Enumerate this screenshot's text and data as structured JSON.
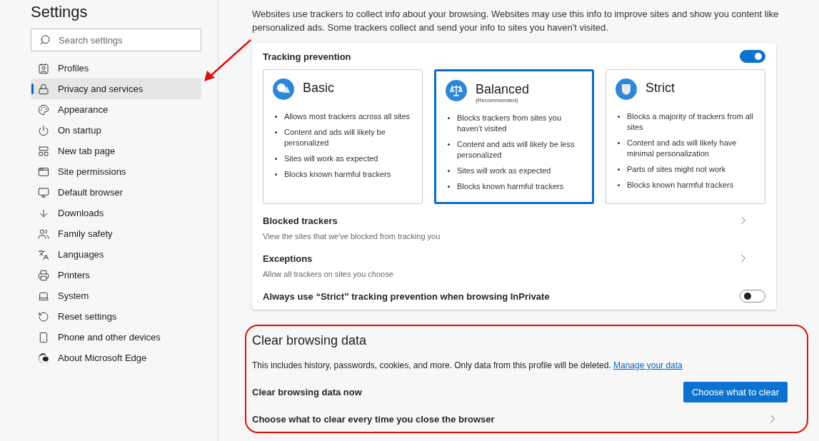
{
  "sidebar": {
    "title": "Settings",
    "search": {
      "placeholder": "Search settings"
    },
    "items": [
      {
        "label": "Profiles",
        "selected": false
      },
      {
        "label": "Privacy and services",
        "selected": true
      },
      {
        "label": "Appearance",
        "selected": false
      },
      {
        "label": "On startup",
        "selected": false
      },
      {
        "label": "New tab page",
        "selected": false
      },
      {
        "label": "Site permissions",
        "selected": false
      },
      {
        "label": "Default browser",
        "selected": false
      },
      {
        "label": "Downloads",
        "selected": false
      },
      {
        "label": "Family safety",
        "selected": false
      },
      {
        "label": "Languages",
        "selected": false
      },
      {
        "label": "Printers",
        "selected": false
      },
      {
        "label": "System",
        "selected": false
      },
      {
        "label": "Reset settings",
        "selected": false
      },
      {
        "label": "Phone and other devices",
        "selected": false
      },
      {
        "label": "About Microsoft Edge",
        "selected": false
      }
    ]
  },
  "intro": "Websites use trackers to collect info about your browsing. Websites may use this info to improve sites and show you content like personalized ads. Some trackers collect and send your info to sites you haven't visited.",
  "tracking": {
    "title": "Tracking prevention",
    "on": true,
    "levels": [
      {
        "title": "Basic",
        "selected": false,
        "bullets": [
          "Allows most trackers across all sites",
          "Content and ads will likely be personalized",
          "Sites will work as expected",
          "Blocks known harmful trackers"
        ]
      },
      {
        "title": "Balanced",
        "subtitle": "(Recommended)",
        "selected": true,
        "bullets": [
          "Blocks trackers from sites you haven't visited",
          "Content and ads will likely be less personalized",
          "Sites will work as expected",
          "Blocks known harmful trackers"
        ]
      },
      {
        "title": "Strict",
        "selected": false,
        "bullets": [
          "Blocks a majority of trackers from all sites",
          "Content and ads will likely have minimal personalization",
          "Parts of sites might not work",
          "Blocks known harmful trackers"
        ]
      }
    ],
    "rows": [
      {
        "title": "Blocked trackers",
        "description": "View the sites that we've blocked from tracking you"
      },
      {
        "title": "Exceptions",
        "description": "Allow all trackers on sites you choose"
      }
    ],
    "inprivate": {
      "label": "Always use “Strict” tracking prevention when browsing InPrivate",
      "on": false
    }
  },
  "clear": {
    "title": "Clear browsing data",
    "description": "This includes history, passwords, cookies, and more. Only data from this profile will be deleted.",
    "link": "Manage your data",
    "now": {
      "label": "Clear browsing data now",
      "button": "Choose what to clear"
    },
    "on_close": {
      "label": "Choose what to clear every time you close the browser"
    }
  }
}
